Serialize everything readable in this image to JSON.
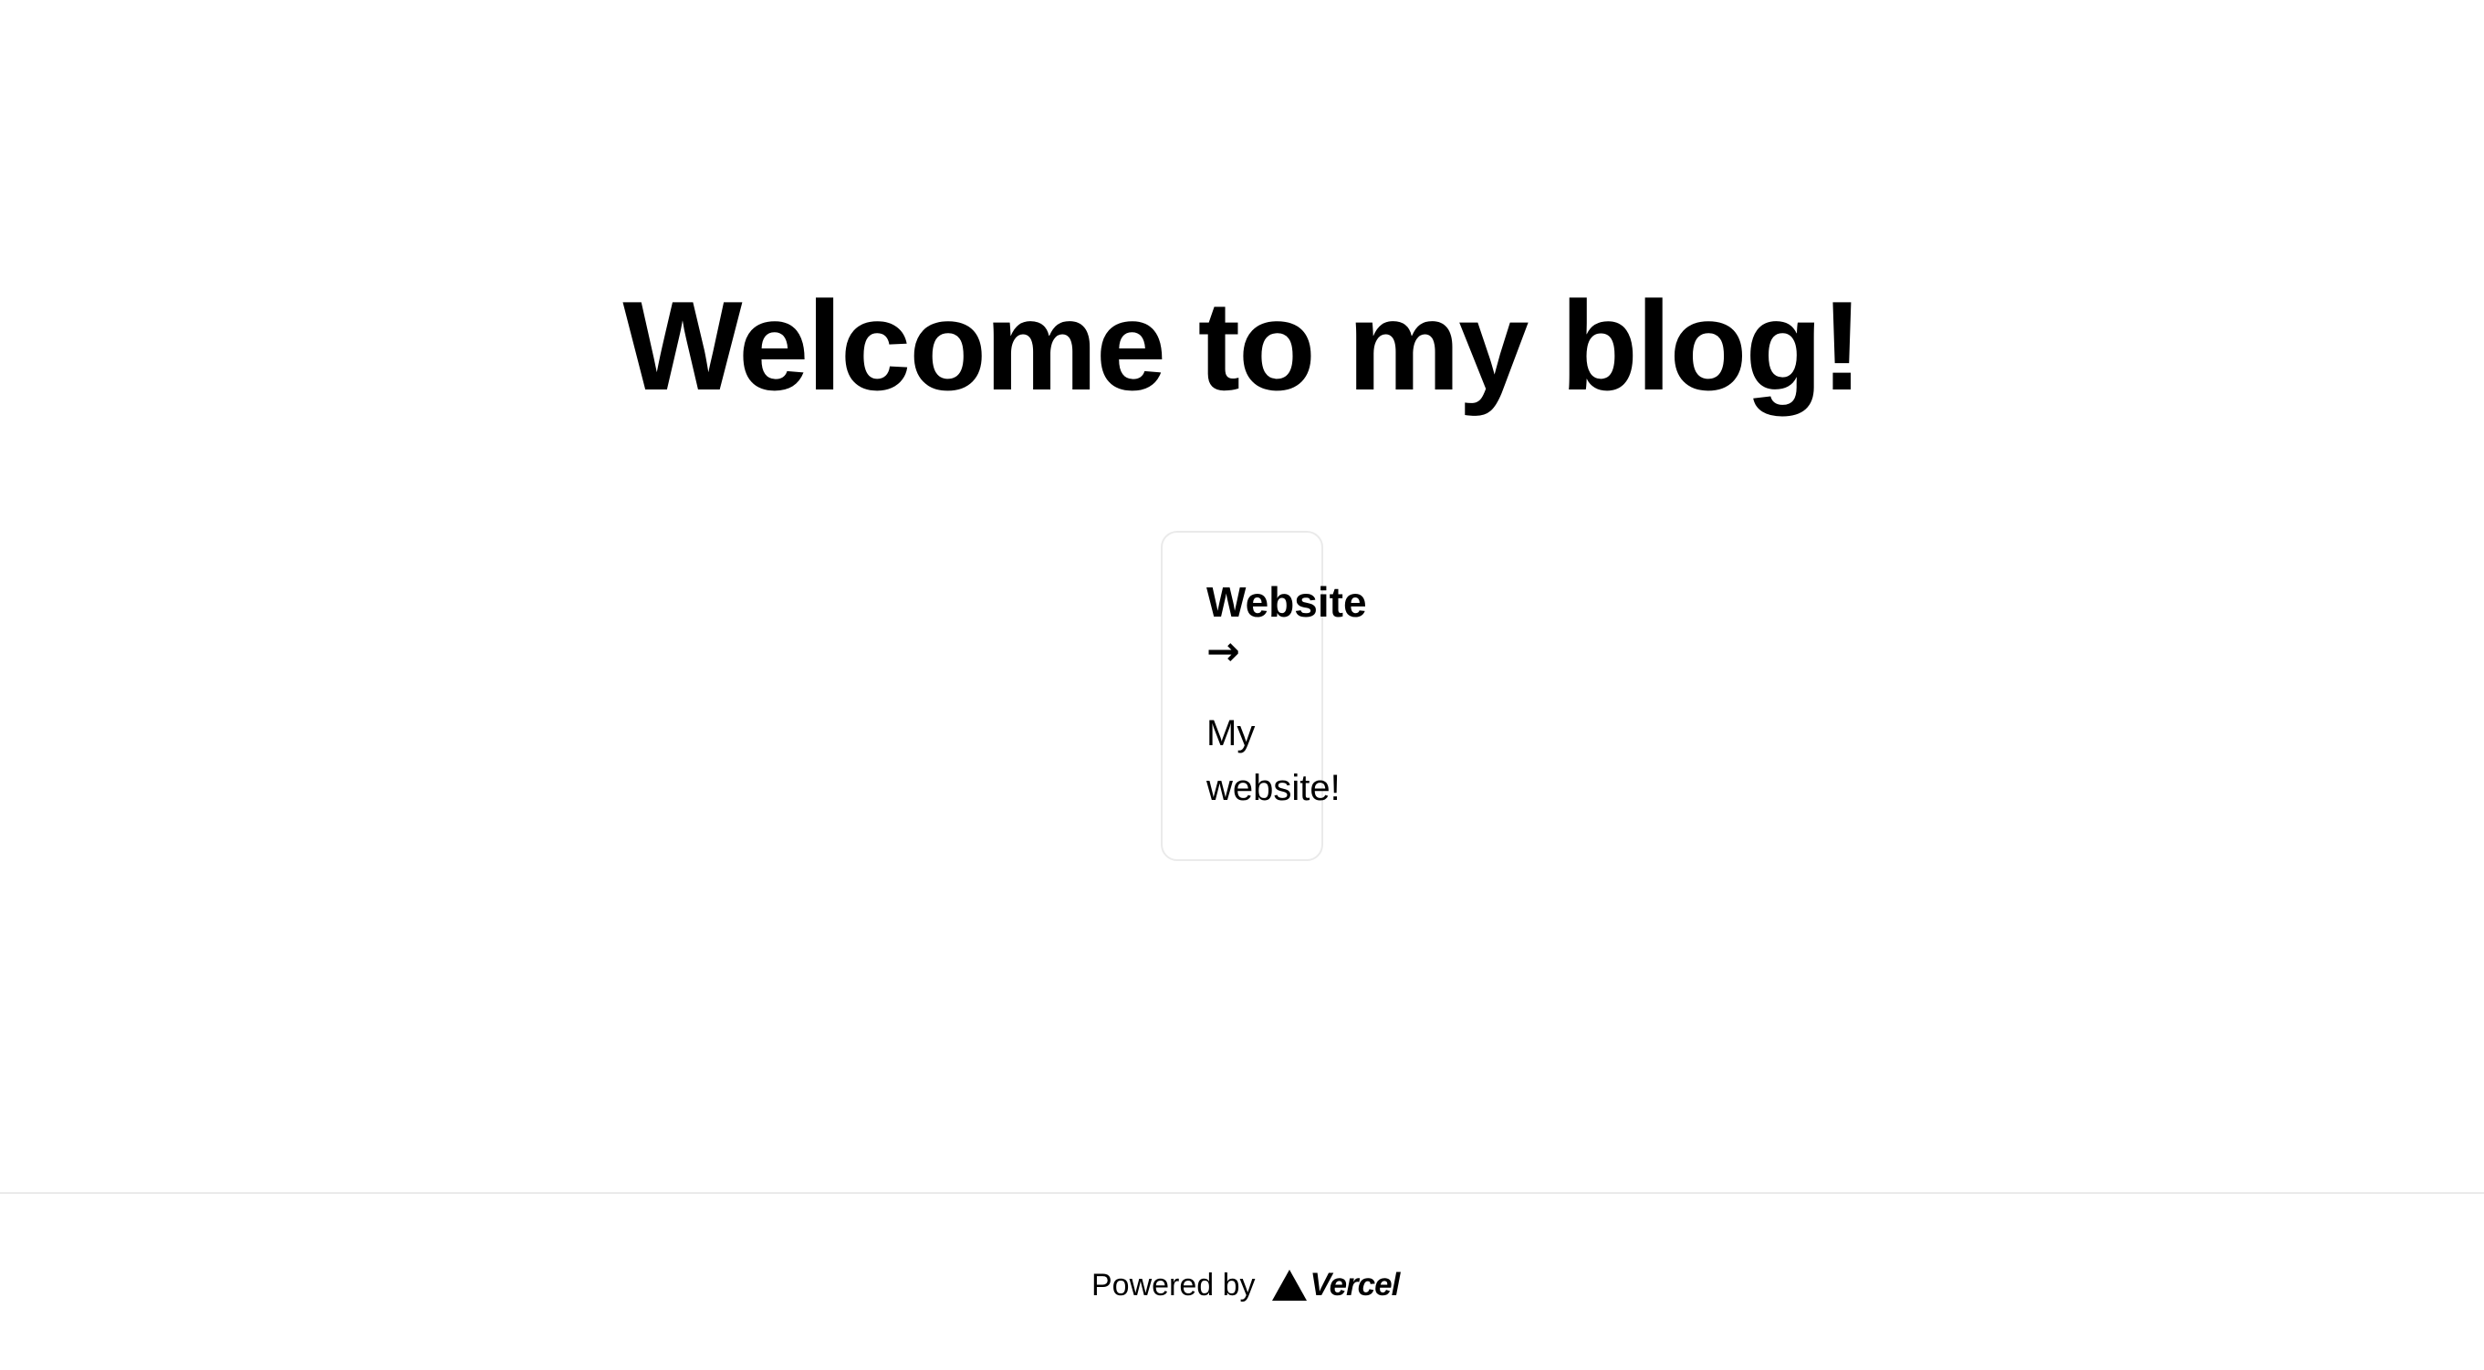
{
  "main": {
    "title": "Welcome to my blog!",
    "cards": [
      {
        "title": "Website",
        "arrow": "→",
        "description_line1": "My",
        "description_line2": "website!"
      }
    ]
  },
  "footer": {
    "powered_by": "Powered by",
    "brand": "Vercel",
    "brand_icon": "triangle-icon"
  },
  "colors": {
    "background": "#ffffff",
    "text": "#000000",
    "border": "#eaeaea"
  }
}
